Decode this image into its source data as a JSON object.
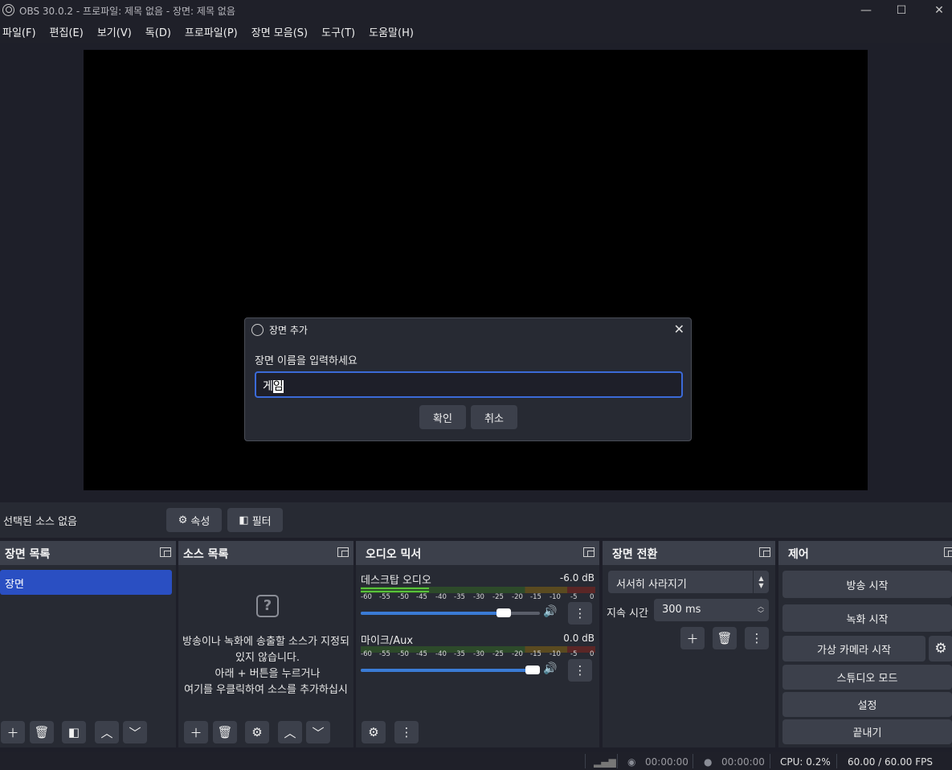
{
  "window": {
    "title": "OBS 30.0.2 - 프로파일: 제목 없음 - 장면: 제목 없음",
    "minimize": "—",
    "maximize": "☐",
    "close": "✕"
  },
  "menu": [
    "파일(F)",
    "편집(E)",
    "보기(V)",
    "독(D)",
    "프로파일(P)",
    "장면 모음(S)",
    "도구(T)",
    "도움말(H)"
  ],
  "dialog": {
    "title": "장면 추가",
    "prompt": "장면 이름을 입력하세요",
    "input_value_prefix": "게",
    "input_value_selected": "임",
    "ok_label": "확인",
    "cancel_label": "취소",
    "close": "✕"
  },
  "source_toolbar": {
    "no_source": "선택된 소스 없음",
    "properties_label": "속성",
    "filters_label": "필터"
  },
  "docks": {
    "scenes": {
      "title": "장면 목록",
      "items": [
        "장면"
      ]
    },
    "sources": {
      "title": "소스 목록",
      "empty_lines": [
        "방송이나 녹화에 송출할 소스가 지정되",
        "있지 않습니다.",
        "아래 + 버튼을 누르거나",
        "여기를 우클릭하여 소스를 추가하십시"
      ]
    },
    "mixer": {
      "title": "오디오 믹서",
      "scale": [
        "-60",
        "-55",
        "-50",
        "-45",
        "-40",
        "-35",
        "-30",
        "-25",
        "-20",
        "-15",
        "-10",
        "-5",
        "0"
      ],
      "channels": [
        {
          "name": "데스크탑 오디오",
          "db": "-6.0 dB",
          "level": 0.29,
          "volume": 0.8
        },
        {
          "name": "마이크/Aux",
          "db": "0.0 dB",
          "level": 0,
          "volume": 1.0
        }
      ]
    },
    "transitions": {
      "title": "장면 전환",
      "selected": "서서히 사라지기",
      "duration_label": "지속 시간",
      "duration_value": "300 ms"
    },
    "controls": {
      "title": "제어",
      "start_streaming": "방송 시작",
      "start_recording": "녹화 시작",
      "virtual_camera": "가상 카메라 시작",
      "studio_mode": "스튜디오 모드",
      "settings": "설정",
      "exit": "끝내기"
    }
  },
  "status": {
    "stream_time": "00:00:00",
    "record_time": "00:00:00",
    "cpu": "CPU: 0.2%",
    "fps": "60.00 / 60.00 FPS"
  },
  "colors": {
    "accent": "#2a4fc2",
    "input_focus": "#3b6ad8",
    "background": "#1e1f29",
    "panel": "#272a33",
    "button": "#3c404b"
  }
}
